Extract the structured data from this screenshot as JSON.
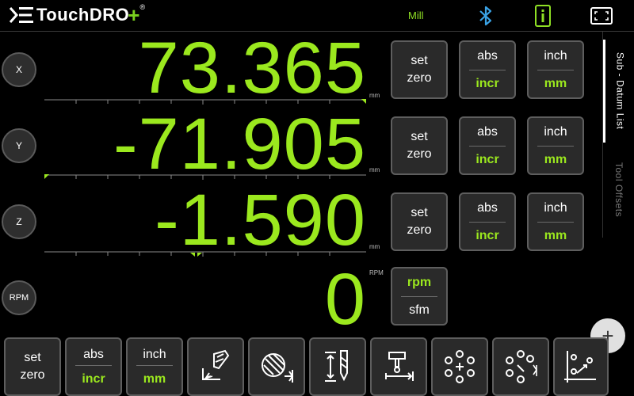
{
  "header": {
    "logo_text": "TouchDRO",
    "logo_plus": "+",
    "logo_reg": "®",
    "mode": "Mill",
    "icons": [
      "menu-icon",
      "bluetooth-icon",
      "info-icon",
      "fullscreen-icon"
    ]
  },
  "axes": [
    {
      "label": "X",
      "value": "73.365",
      "unit": "mm"
    },
    {
      "label": "Y",
      "value": "-71.905",
      "unit": "mm"
    },
    {
      "label": "Z",
      "value": "-1.590",
      "unit": "mm"
    },
    {
      "label": "RPM",
      "value": "0",
      "unit": "RPM"
    }
  ],
  "axis_buttons": {
    "set_zero": [
      "set",
      "zero"
    ],
    "abs_incr": [
      "abs",
      "incr"
    ],
    "inch_mm": [
      "inch",
      "mm"
    ],
    "rpm_sfm": [
      "rpm",
      "sfm"
    ]
  },
  "tabs": {
    "sub_datum": "Sub - Datum List",
    "tool_offsets": "Tool Offsets"
  },
  "fab": "+",
  "toolbar": {
    "set_zero": [
      "set",
      "zero"
    ],
    "abs_incr": [
      "abs",
      "incr"
    ],
    "inch_mm": [
      "inch",
      "mm"
    ],
    "tools": [
      "tool-offset-icon",
      "end-mill-icon",
      "drill-depth-icon",
      "probe-icon",
      "bolt-circle-icon",
      "bolt-circle-arc-icon",
      "grid-pattern-icon"
    ]
  },
  "colors": {
    "accent": "#9be81e",
    "background": "#000000",
    "button": "#2a2a2a",
    "button_border": "#5e5e5e"
  }
}
